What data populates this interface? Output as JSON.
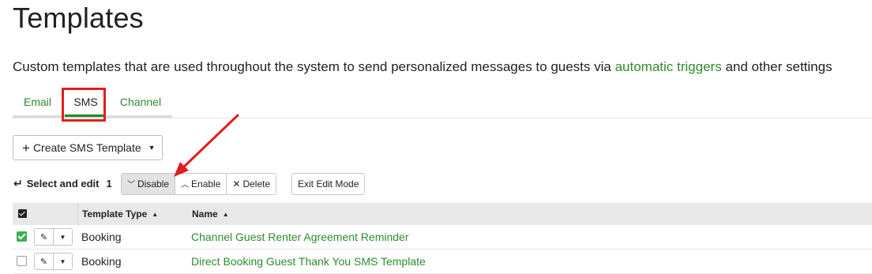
{
  "page": {
    "title": "Templates",
    "description_prefix": "Custom templates that are used throughout the system to send personalized messages to guests via ",
    "description_link": "automatic triggers",
    "description_suffix": " and other settings"
  },
  "tabs": [
    {
      "label": "Email",
      "active": false
    },
    {
      "label": "SMS",
      "active": true
    },
    {
      "label": "Channel",
      "active": false
    }
  ],
  "toolbar": {
    "create_label": "Create SMS Template",
    "select_edit_label": "Select and edit",
    "selected_count": "1",
    "disable_label": "Disable",
    "enable_label": "Enable",
    "delete_label": "Delete",
    "exit_edit_label": "Exit Edit Mode"
  },
  "table": {
    "columns": [
      "Template Type",
      "Name"
    ],
    "rows": [
      {
        "type": "Booking",
        "name": "Channel Guest Renter Agreement Reminder",
        "checked": true
      },
      {
        "type": "Booking",
        "name": "Direct Booking Guest Thank You SMS Template",
        "checked": false
      }
    ]
  },
  "annotation": {
    "highlight_color": "#e01e1e"
  },
  "colors": {
    "accent_green": "#2e8b2e",
    "checkbox_green": "#3cae50"
  },
  "icons": {
    "create": "plus-icon",
    "create_caret": "caret-down-icon",
    "select_edit": "return-arrow-icon",
    "disable": "chevron-down-icon",
    "enable": "chevron-up-icon",
    "delete": "x-icon",
    "sort": "sort-asc-icon",
    "edit": "pencil-icon",
    "row_menu": "caret-down-icon"
  }
}
